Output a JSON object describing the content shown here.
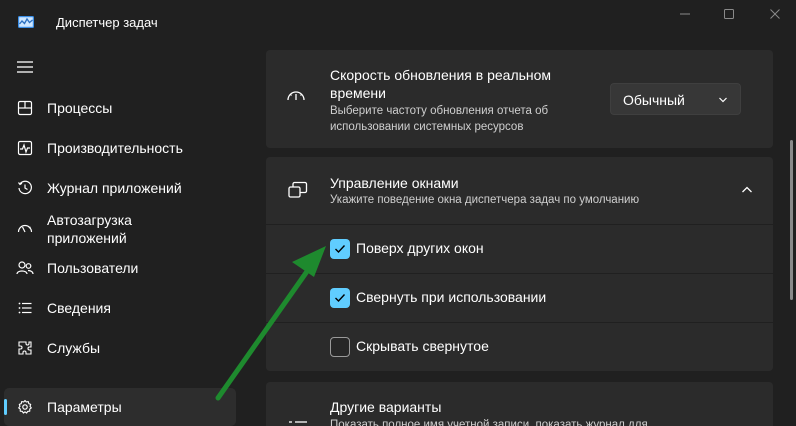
{
  "window": {
    "title": "Диспетчер задач"
  },
  "sidebar": {
    "items": [
      {
        "label": "Процессы",
        "icon": "processes-grid-icon"
      },
      {
        "label": "Производительность",
        "icon": "performance-pulse-icon"
      },
      {
        "label": "Журнал приложений",
        "icon": "history-clock-icon"
      },
      {
        "label": "Автозагрузка приложений",
        "line1": "Автозагрузка",
        "line2": "приложений",
        "icon": "startup-gauge-icon"
      },
      {
        "label": "Пользователи",
        "icon": "users-icon"
      },
      {
        "label": "Сведения",
        "icon": "details-list-icon"
      },
      {
        "label": "Службы",
        "icon": "services-puzzle-icon"
      },
      {
        "label": "Параметры",
        "icon": "settings-gear-icon",
        "active": true
      }
    ]
  },
  "main": {
    "update_speed": {
      "title_line1": "Скорость обновления в реальном",
      "title_line2": "времени",
      "desc_line1": "Выберите частоту обновления отчета об",
      "desc_line2": "использовании системных ресурсов",
      "dropdown_value": "Обычный"
    },
    "window_management": {
      "title": "Управление окнами",
      "desc": "Укажите поведение окна диспетчера задач по умолчанию",
      "options": [
        {
          "label": "Поверх других окон",
          "checked": true
        },
        {
          "label": "Свернуть при использовании",
          "checked": true
        },
        {
          "label": "Скрывать свернутое",
          "checked": false
        }
      ]
    },
    "other_options": {
      "title": "Другие варианты",
      "desc": "Показать полное имя учетной записи, показать журнал для"
    }
  },
  "colors": {
    "background": "#202020",
    "card": "#2b2b2b",
    "accent": "#60cdff",
    "annotation_arrow": "#1e8a2e"
  }
}
